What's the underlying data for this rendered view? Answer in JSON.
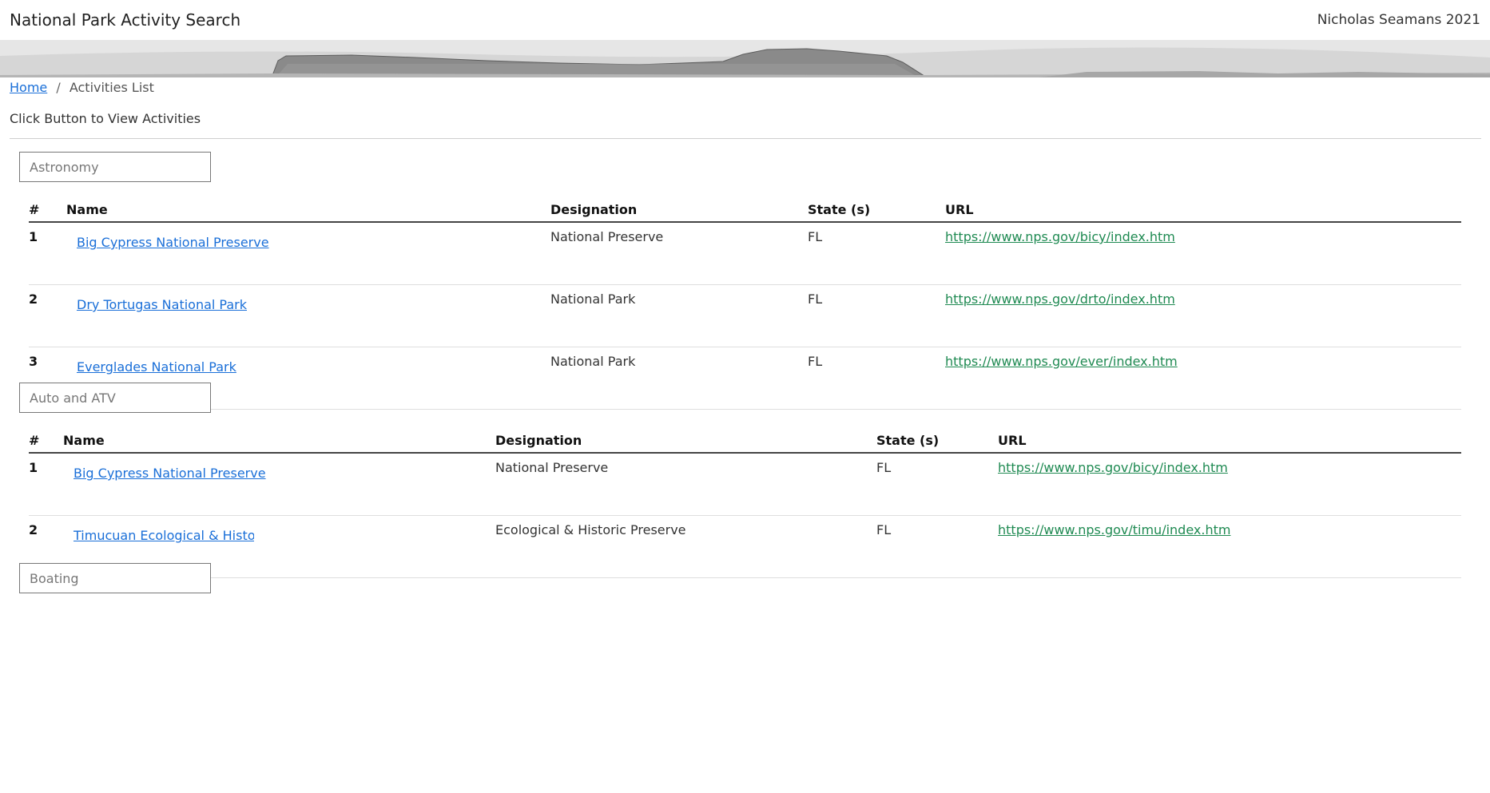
{
  "header": {
    "title": "National Park Activity Search",
    "author": "Nicholas Seamans 2021"
  },
  "breadcrumb": {
    "home": "Home",
    "separator": "/",
    "current": "Activities List"
  },
  "instructions": "Click Button to View Activities",
  "table_headers": {
    "num": "#",
    "name": "Name",
    "designation": "Designation",
    "state": "State (s)",
    "url": "URL"
  },
  "activities": [
    {
      "label": "Astronomy",
      "parks": [
        {
          "num": "1",
          "name": "Big Cypress National Preserve",
          "designation": "National Preserve",
          "state": "FL",
          "url": "https://www.nps.gov/bicy/index.htm"
        },
        {
          "num": "2",
          "name": "Dry Tortugas National Park",
          "designation": "National Park",
          "state": "FL",
          "url": "https://www.nps.gov/drto/index.htm"
        },
        {
          "num": "3",
          "name": "Everglades National Park",
          "designation": "National Park",
          "state": "FL",
          "url": "https://www.nps.gov/ever/index.htm"
        }
      ]
    },
    {
      "label": "Auto and ATV",
      "parks": [
        {
          "num": "1",
          "name": "Big Cypress National Preserve",
          "designation": "National Preserve",
          "state": "FL",
          "url": "https://www.nps.gov/bicy/index.htm"
        },
        {
          "num": "2",
          "name": "Timucuan Ecological & Historic Preserve",
          "designation": "Ecological & Historic Preserve",
          "state": "FL",
          "url": "https://www.nps.gov/timu/index.htm"
        }
      ]
    },
    {
      "label": "Boating",
      "parks": []
    }
  ],
  "colors": {
    "link": "#1a6fd8",
    "url_link": "#1f8a52"
  }
}
